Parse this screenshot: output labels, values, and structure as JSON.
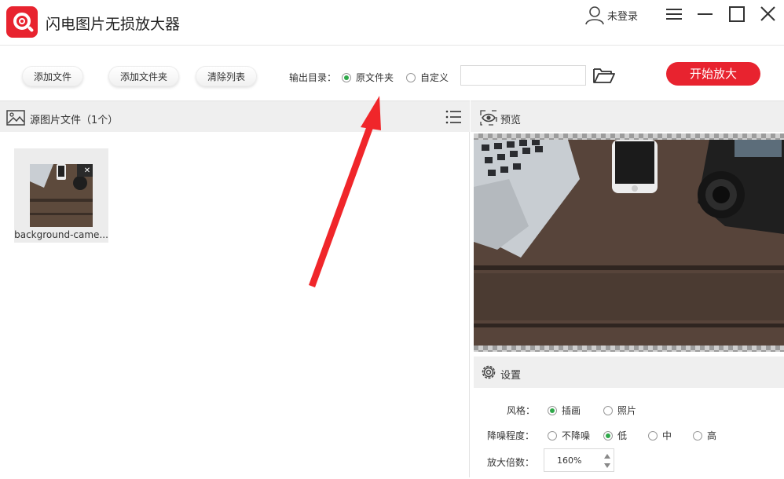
{
  "app": {
    "title": "闪电图片无损放大器",
    "user_label": "未登录"
  },
  "toolbar": {
    "add_file": "添加文件",
    "add_folder": "添加文件夹",
    "clear_list": "清除列表",
    "output_label": "输出目录：",
    "output_original": "原文件夹",
    "output_custom": "自定义",
    "output_selected": "原文件夹",
    "custom_path_value": "",
    "start_label": "开始放大"
  },
  "source": {
    "header": "源图片文件（1个）",
    "files": [
      {
        "name": "background-came..."
      }
    ]
  },
  "preview": {
    "header": "预览"
  },
  "settings": {
    "header": "设置",
    "style_label": "风格：",
    "style_options": [
      "插画",
      "照片"
    ],
    "style_selected": "插画",
    "denoise_label": "降噪程度：",
    "denoise_options": [
      "不降噪",
      "低",
      "中",
      "高"
    ],
    "denoise_selected": "低",
    "scale_label": "放大倍数：",
    "scale_value": "160%"
  },
  "colors": {
    "accent_red": "#e8232f",
    "radio_green": "#2fa84a",
    "arrow_red": "#f0262a"
  }
}
